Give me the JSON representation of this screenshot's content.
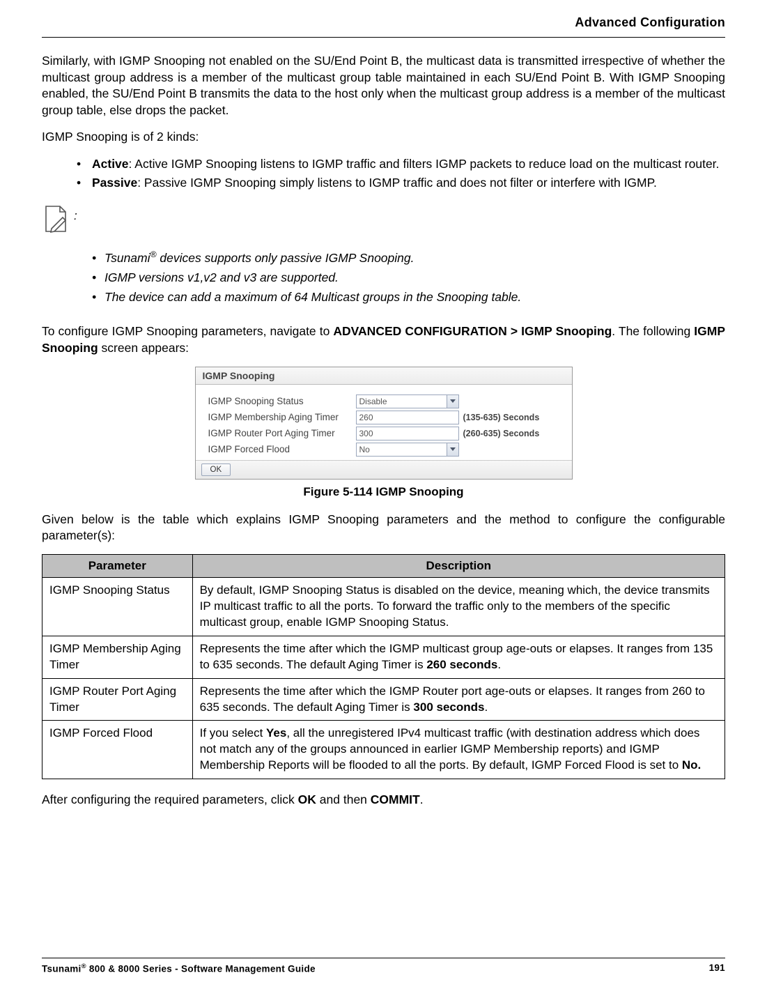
{
  "header": {
    "title": "Advanced Configuration"
  },
  "intro": {
    "p1": "Similarly, with IGMP Snooping not enabled on the SU/End Point B, the multicast data is transmitted irrespective of whether the multicast group address is a member of the multicast group table maintained in each SU/End Point B. With IGMP Snooping enabled, the SU/End Point B transmits the data to the host only when the multicast group address is a member of the multicast group table, else drops the packet.",
    "p2": "IGMP Snooping is of 2 kinds:"
  },
  "kinds": [
    {
      "label": "Active",
      "text": ": Active IGMP Snooping listens to IGMP traffic and filters IGMP packets to reduce load on the multicast router."
    },
    {
      "label": "Passive",
      "text": ": Passive IGMP Snooping simply listens to IGMP traffic and does not filter or interfere with IGMP."
    }
  ],
  "note_colon": ":",
  "notes": {
    "n1_pre": "Tsunami",
    "n1_sup": "®",
    "n1_post": " devices supports only passive IGMP Snooping.",
    "n2": "IGMP versions v1,v2 and v3 are supported.",
    "n3": "The device can add a maximum of 64 Multicast groups in the Snooping table."
  },
  "nav": {
    "pre": "To configure IGMP Snooping parameters, navigate to ",
    "path": "ADVANCED CONFIGURATION > IGMP Snooping",
    "post1": ". The following ",
    "screen": "IGMP Snooping",
    "post2": " screen appears:"
  },
  "ui": {
    "title": "IGMP Snooping",
    "rows": {
      "status_label": "IGMP Snooping Status",
      "status_value": "Disable",
      "mem_label": "IGMP Membership Aging Timer",
      "mem_value": "260",
      "mem_hint": "(135-635) Seconds",
      "rtr_label": "IGMP Router Port Aging Timer",
      "rtr_value": "300",
      "rtr_hint": "(260-635) Seconds",
      "flood_label": "IGMP Forced Flood",
      "flood_value": "No"
    },
    "ok": "OK"
  },
  "figure_caption": "Figure 5-114 IGMP Snooping",
  "table_intro": "Given below is the table which explains IGMP Snooping parameters and the method to configure the configurable parameter(s):",
  "table": {
    "head_param": "Parameter",
    "head_desc": "Description",
    "rows": {
      "r1p": "IGMP Snooping Status",
      "r1d": "By default, IGMP Snooping Status is disabled on the device, meaning which, the device transmits IP multicast traffic to all the ports. To forward the traffic only to the members of the specific multicast group, enable IGMP Snooping Status.",
      "r2p": "IGMP Membership Aging Timer",
      "r2d_pre": "Represents the time after which the IGMP multicast group age-outs or elapses. It ranges from 135 to 635 seconds. The default Aging Timer is ",
      "r2d_bold": "260 seconds",
      "r2d_post": ".",
      "r3p": "IGMP Router Port Aging Timer",
      "r3d_pre": "Represents the time after which the IGMP Router port age-outs or elapses. It ranges from 260 to 635 seconds. The default Aging Timer is ",
      "r3d_bold": "300 seconds",
      "r3d_post": ".",
      "r4p": "IGMP Forced Flood",
      "r4d_pre": "If you select ",
      "r4d_yes": "Yes",
      "r4d_mid": ", all the unregistered IPv4 multicast traffic (with destination address which does not match any of the groups announced in earlier IGMP Membership reports) and IGMP Membership Reports will be flooded to all the ports. By default, IGMP Forced Flood is set to ",
      "r4d_no": "No.",
      "r4d_post": ""
    }
  },
  "after": {
    "pre": "After configuring the required parameters, click ",
    "ok": "OK",
    "mid": " and then ",
    "commit": "COMMIT",
    "post": "."
  },
  "footer": {
    "left_pre": "Tsunami",
    "left_sup": "®",
    "left_post": " 800 & 8000 Series - Software Management Guide",
    "page_no": "191"
  }
}
